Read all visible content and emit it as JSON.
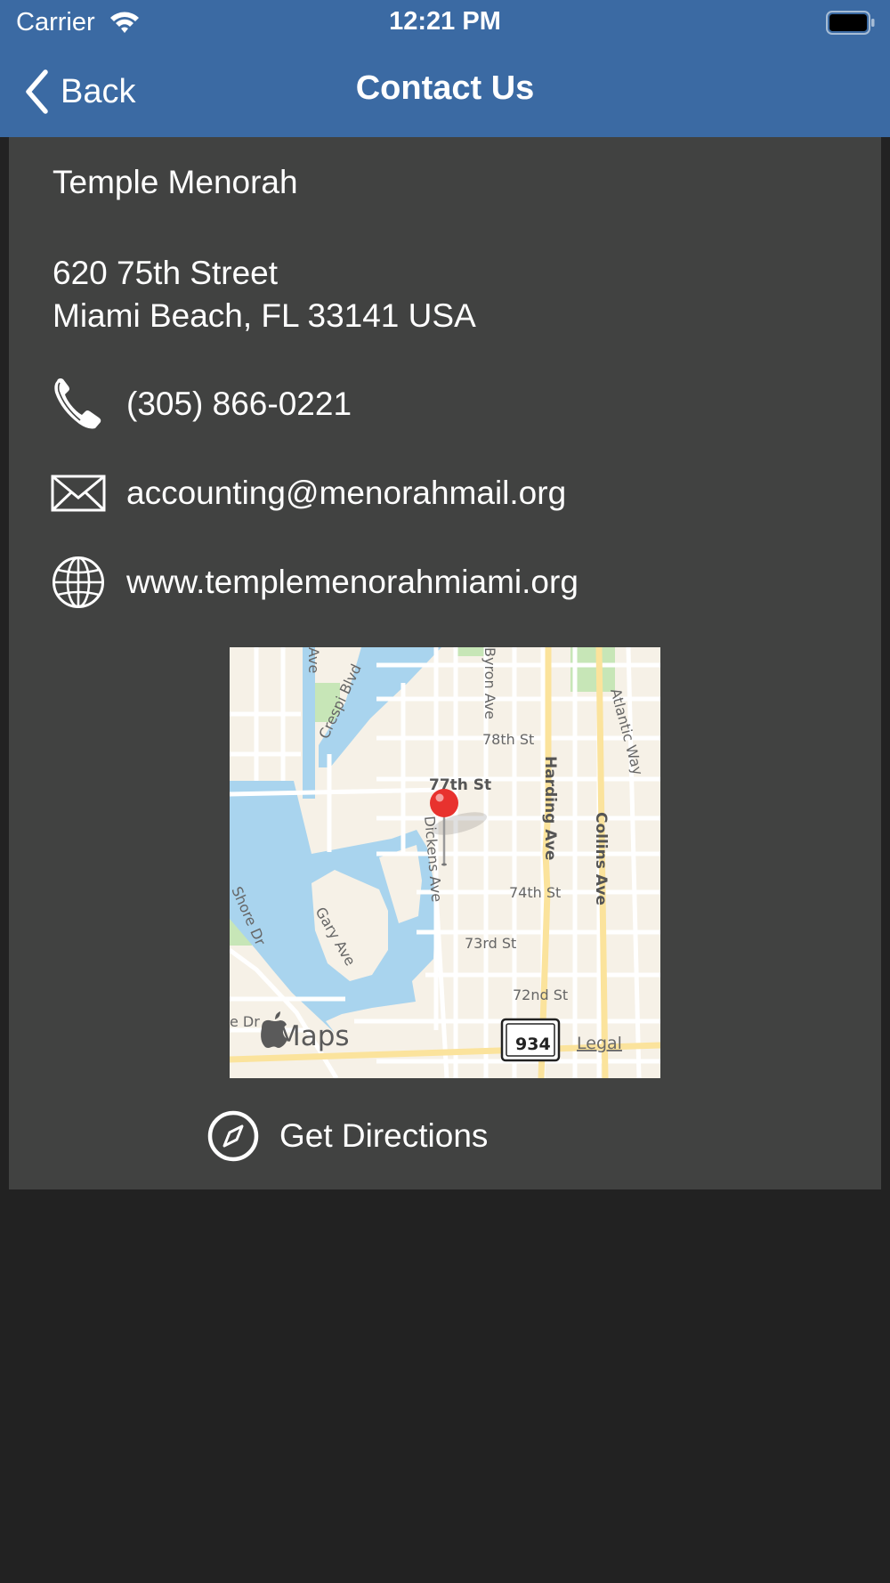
{
  "status_bar": {
    "carrier": "Carrier",
    "time": "12:21 PM",
    "icons": [
      "wifi-icon",
      "battery-icon"
    ]
  },
  "nav": {
    "back_label": "Back",
    "title": "Contact Us",
    "icons": [
      "chevron-left-icon"
    ]
  },
  "contact": {
    "name": "Temple Menorah",
    "address_line1": "620 75th Street",
    "address_line2": "Miami Beach, FL 33141 USA",
    "phone": "(305) 866-0221",
    "email": "accounting@menorahmail.org",
    "website": "www.templemenorahmiami.org",
    "icons": [
      "phone-icon",
      "envelope-icon",
      "globe-icon"
    ]
  },
  "map": {
    "streets": [
      "77th St",
      "78th St",
      "74th St",
      "73rd St",
      "72nd St",
      "Harding Ave",
      "Collins Ave",
      "Atlantic Way",
      "Dickens Ave",
      "Gary Ave",
      "Crespi Blvd",
      "Shore Dr",
      "Byron Ave",
      "Ave",
      "e Dr"
    ],
    "brand": "Maps",
    "legal": "Legal",
    "route_shield": "934",
    "icons": [
      "map-pin-icon",
      "apple-logo-icon",
      "route-shield-icon"
    ]
  },
  "directions": {
    "label": "Get Directions",
    "icon": "compass-icon"
  },
  "colors": {
    "header": "#3b6aa3",
    "card": "#414241",
    "background": "#222222",
    "map_land": "#f6f1e7",
    "map_water": "#a9d4ee",
    "map_park": "#c7e6b7",
    "map_major_road": "#fbe39c",
    "pin": "#e8322e"
  }
}
